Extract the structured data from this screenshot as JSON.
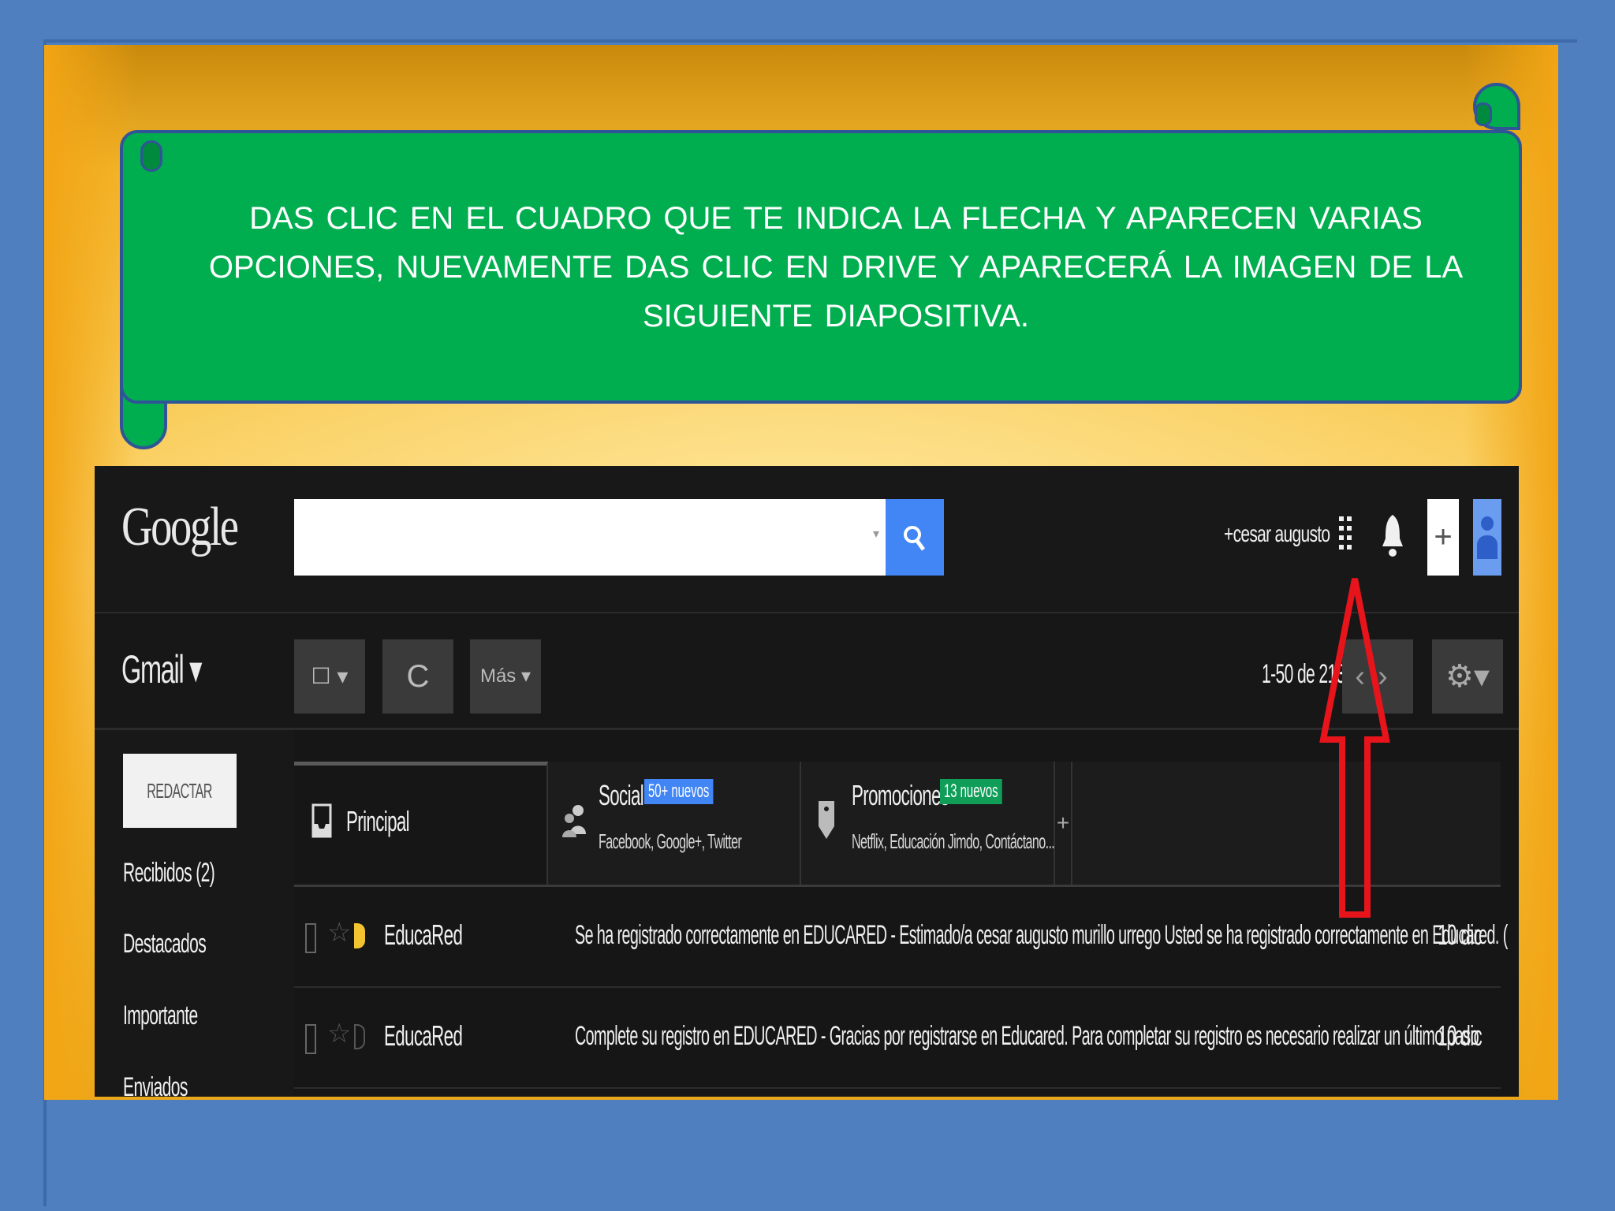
{
  "slide": {
    "instruction": "DAS CLIC EN  EL CUADRO QUE  TE INDICA LA  FLECHA Y APARECEN  VARIAS OPCIONES,  NUEVAMENTE DAS CLIC  EN  DRIVE Y APARECERÁ  LA  IMAGEN  DE LA  SIGUIENTE DIAPOSITIVA.",
    "arrow_color": "#e8141b",
    "banner_color": "#00ae4f"
  },
  "gmail": {
    "logo": "Google",
    "search": {
      "value": "",
      "caret": "▾",
      "button_icon": "search-icon"
    },
    "user_name": "+cesar augusto",
    "apps_icon": "apps-grid-icon",
    "notifications_icon": "bell-icon",
    "share_label": "+",
    "avatar_icon": "person-icon",
    "product_label": "Gmail ▾",
    "toolbar": {
      "select_label": "☐ ▾",
      "refresh_label": "C",
      "more_label": "Más ▾"
    },
    "pagination": {
      "count": "1-50 de 213",
      "prev": "‹",
      "next": "›"
    },
    "settings_label": "⚙▾",
    "compose_label": "REDACTAR",
    "folders": [
      "Recibidos (2)",
      "Destacados",
      "Importante",
      "Enviados"
    ],
    "tabs": [
      {
        "title": "Principal",
        "subtitle": "",
        "badge": "",
        "badge_color": ""
      },
      {
        "title": "Social",
        "subtitle": "Facebook, Google+, Twitter",
        "badge": "50+ nuevos",
        "badge_color": "#4285f4"
      },
      {
        "title": "Promociones",
        "subtitle": "Netflix, Educación Jimdo, Contáctano...",
        "badge": "13 nuevos",
        "badge_color": "#0f9d58"
      }
    ],
    "add_tab_label": "+",
    "messages": [
      {
        "sender": "EducaRed",
        "text": "Se ha registrado correctamente en EDUCARED - Estimado/a cesar augusto murillo urrego Usted se ha registrado correctamente en Educared. (",
        "date": "10 dic",
        "important": true
      },
      {
        "sender": "EducaRed",
        "text": "Complete su registro en EDUCARED - Gracias por registrarse en Educared. Para completar su registro es necesario realizar un último paso",
        "date": "10 dic",
        "important": false
      }
    ]
  }
}
